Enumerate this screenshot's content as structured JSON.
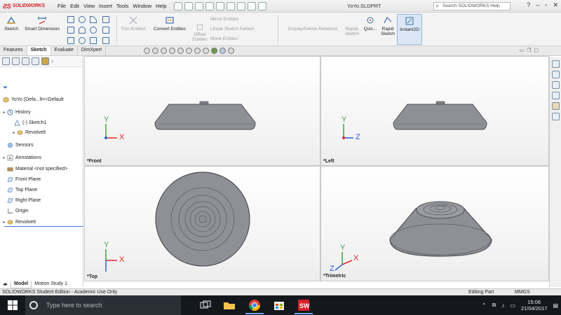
{
  "app": {
    "logo_text": "SOLIDWORKS",
    "document_title": "YoYo.SLDPRT",
    "search_placeholder": "Search SOLIDWORKS Help"
  },
  "menu": [
    "File",
    "Edit",
    "View",
    "Insert",
    "Tools",
    "Window",
    "Help"
  ],
  "ribbon": {
    "sketch": "Sketch",
    "smart_dimension": "Smart Dimension",
    "trim_entities": "Trim Entities",
    "convert_entities": "Convert Entities",
    "offset_entities": "Offset Entities",
    "mirror_entities": "Mirror Entities",
    "linear_sketch_pattern": "Linear Sketch Pattern",
    "move_entities": "Move Entities",
    "display_delete_relations": "Display/Delete Relations",
    "repair_sketch": "Repair Sketch",
    "quick_snaps": "Quic...",
    "rapid_sketch": "Rapid Sketch",
    "instant2d": "Instant2D"
  },
  "command_tabs": [
    "Features",
    "Sketch",
    "Evaluate",
    "DimXpert"
  ],
  "tree": {
    "root": "YoYo  (Defa...lt<<Default",
    "history": "History",
    "sketch1": "(-) Sketch1",
    "revolve6_hist": "Revolve6",
    "sensors": "Sensors",
    "annotations": "Annotations",
    "material": "Material <not specified>",
    "front_plane": "Front Plane",
    "top_plane": "Top Plane",
    "right_plane": "Right Plane",
    "origin": "Origin",
    "revolve6": "Revolve6"
  },
  "bottom_tabs": [
    "Model",
    "Motion Study 1"
  ],
  "viewports": {
    "front": "*Front",
    "left": "*Left",
    "top": "*Top",
    "trimetric": "*Trimetric"
  },
  "axes": {
    "x": "X",
    "y": "Y",
    "z": "Z"
  },
  "status": {
    "left": "SOLIDWORKS Student Edition - Academic Use Only",
    "editing": "Editing Part",
    "units": "MMGS"
  },
  "taskbar": {
    "search": "Type here to search",
    "time": "15:06",
    "date": "21/04/2017"
  },
  "colors": {
    "part_gray": "#8e9096",
    "axis_x": "#e2262b",
    "axis_y": "#3ea342",
    "axis_z": "#2b5fd1",
    "solidworks_red": "#d52027"
  }
}
